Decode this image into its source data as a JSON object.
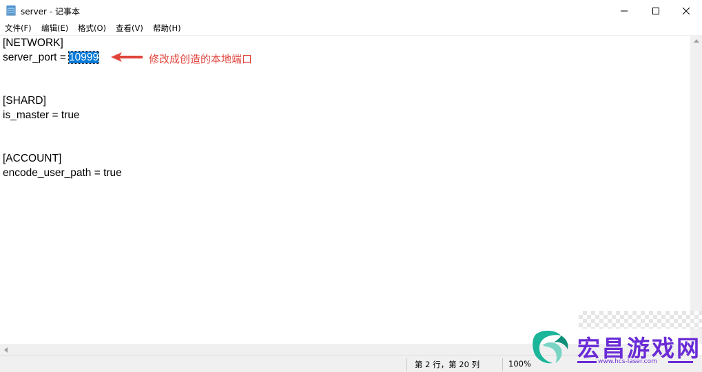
{
  "window": {
    "title": "server - 记事本",
    "controls": {
      "minimize_icon": "minimize-icon",
      "maximize_icon": "maximize-icon",
      "close_icon": "close-icon"
    }
  },
  "menu": {
    "items": [
      {
        "label": "文件(F)"
      },
      {
        "label": "编辑(E)"
      },
      {
        "label": "格式(O)"
      },
      {
        "label": "查看(V)"
      },
      {
        "label": "帮助(H)"
      }
    ]
  },
  "editor": {
    "lines": [
      "[NETWORK]",
      "server_port = ",
      "",
      "",
      "[SHARD]",
      "is_master = true",
      "",
      "",
      "[ACCOUNT]",
      "encode_user_path = true"
    ],
    "selected_text": "10999",
    "annotation": "修改成创造的本地端口",
    "annotation_color": "#e0433a",
    "selection_color": "#0078d7"
  },
  "statusbar": {
    "position": "第 2 行，第 20 列",
    "zoom": "100%"
  },
  "watermark": {
    "title": "宏昌游戏网",
    "url": "www.hcs-laser.com",
    "color": "#6a2bd6"
  }
}
